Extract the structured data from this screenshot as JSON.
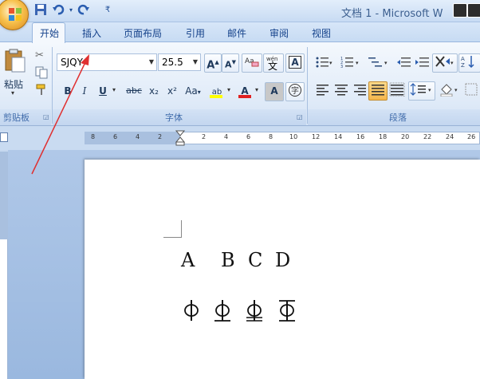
{
  "window": {
    "title": "文档 1 - Microsoft W"
  },
  "quick_access": {
    "save_icon": "save-icon",
    "undo_icon": "undo-icon",
    "redo_icon": "redo-icon"
  },
  "tabs": [
    {
      "label": "开始",
      "active": true
    },
    {
      "label": "插入"
    },
    {
      "label": "页面布局"
    },
    {
      "label": "引用"
    },
    {
      "label": "邮件"
    },
    {
      "label": "审阅"
    },
    {
      "label": "视图"
    }
  ],
  "clipboard": {
    "paste_label": "粘贴",
    "group_label": "剪贴板"
  },
  "font_group": {
    "group_label": "字体",
    "font_name": "SJQY",
    "font_size": "25.5",
    "grow_label": "A",
    "shrink_label": "A",
    "bold_label": "B",
    "italic_label": "I",
    "underline_label": "U",
    "strike_label": "abc",
    "subscript_label": "x₂",
    "superscript_label": "x²",
    "case_label": "Aa",
    "highlight_label": "ab",
    "font_color_label": "A",
    "shade_label": "A",
    "clear_label": "A",
    "phonetic_label": "wén"
  },
  "paragraph_group": {
    "group_label": "段落"
  },
  "ruler": {
    "ticks": [
      "8",
      "6",
      "4",
      "2",
      "2",
      "4",
      "6",
      "8",
      "10",
      "12",
      "14",
      "16",
      "18",
      "20",
      "22",
      "24",
      "26"
    ]
  },
  "document": {
    "letters": [
      "A",
      "B",
      "C",
      "D"
    ],
    "symbols": [
      "symbol-a",
      "symbol-b",
      "symbol-c",
      "symbol-d"
    ]
  },
  "colors": {
    "highlight": "#ffff00",
    "font_color": "#e02020",
    "annotation_arrow": "#e03030"
  }
}
